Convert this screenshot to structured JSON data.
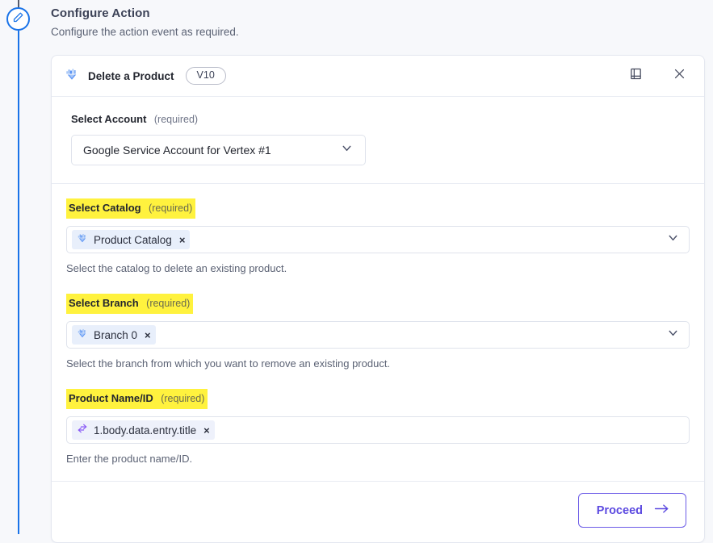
{
  "page": {
    "title": "Configure Action",
    "subtitle": "Configure the action event as required."
  },
  "rail": {
    "node_icon": "pencil-edit-icon"
  },
  "card": {
    "app_icon": "vertex-ai-retail-icon",
    "title": "Delete a Product",
    "version_badge": "V10",
    "docs_icon": "book-icon",
    "close_icon": "close-icon"
  },
  "account": {
    "label": "Select Account",
    "required": "(required)",
    "value": "Google Service Account for Vertex #1",
    "chevron_icon": "chevron-down-icon"
  },
  "fields": [
    {
      "label": "Select Catalog",
      "required": "(required)",
      "highlighted": true,
      "chip_icon": "vertex-ai-retail-icon",
      "chip_label": "Product Catalog",
      "chip_remove": "×",
      "has_chevron": true,
      "chevron_icon": "chevron-down-icon",
      "helper": "Select the catalog to delete an existing product."
    },
    {
      "label": "Select Branch",
      "required": "(required)",
      "highlighted": true,
      "chip_icon": "vertex-ai-retail-icon",
      "chip_label": "Branch 0",
      "chip_remove": "×",
      "has_chevron": true,
      "chevron_icon": "chevron-down-icon",
      "helper": "Select the branch from which you want to remove an existing product."
    },
    {
      "label": "Product Name/ID",
      "required": "(required)",
      "highlighted": true,
      "chip_icon": "variable-swap-icon",
      "chip_label": "1.body.data.entry.title",
      "chip_remove": "×",
      "has_chevron": false,
      "chevron_icon": "",
      "helper": "Enter the product name/ID."
    }
  ],
  "footer": {
    "proceed_label": "Proceed",
    "proceed_icon": "arrow-right-icon"
  },
  "colors": {
    "page_background": "#f7f8fb",
    "card_background": "#ffffff",
    "accent_purple": "#5b49e0",
    "rail_blue": "#1a73e8",
    "highlight_yellow": "#fff23e",
    "chip_blue": "#e8effb",
    "text_primary": "#23262f",
    "text_secondary": "#5b6274"
  }
}
